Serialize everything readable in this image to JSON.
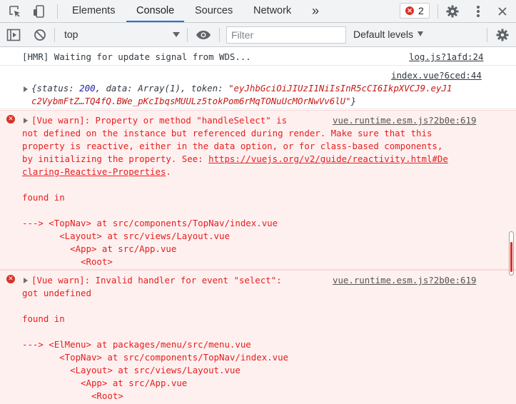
{
  "tabs": [
    {
      "label": "Elements"
    },
    {
      "label": "Console"
    },
    {
      "label": "Sources"
    },
    {
      "label": "Network"
    }
  ],
  "active_tab": "Console",
  "more_tabs_glyph": "»",
  "error_count": "2",
  "toolbar": {
    "context": "top",
    "filter_placeholder": "Filter",
    "levels_label": "Default levels"
  },
  "messages": [
    {
      "type": "log",
      "text": "[HMR] Waiting for update signal from WDS...",
      "source": "log.js?1afd:24"
    },
    {
      "type": "log",
      "source": "index.vue?6ced:44",
      "object": {
        "brace_open": "{",
        "status_key": "status: ",
        "status_val": "200",
        "sep1": ", ",
        "data_key": "data: ",
        "data_val": "Array(1)",
        "sep2": ", ",
        "token_key": "token: ",
        "token_line1": "\"eyJhbGciOiJIUzI1NiIsInR5cCI6IkpXVCJ9.eyJ1",
        "token_line2": "c2VybmFtZ…TQ4fQ.BWe_pKcIbqsMUULz5tokPom6rMqTONuUcMOrNwVv6lU\"",
        "brace_close": "}"
      }
    },
    {
      "type": "error",
      "source": "vue.runtime.esm.js?2b0e:619",
      "first_line": "[Vue warn]: Property or method \"handleSelect\" is",
      "lines": [
        "not defined on the instance but referenced during render. Make sure that this",
        "property is reactive, either in the data option, or for class-based components,",
        "by initializing the property. See: "
      ],
      "link_part1": "https://vuejs.org/v2/guide/reactivity.html#De",
      "link_part2": "claring-Reactive-Properties",
      "link_tail": ".",
      "found_in": "found in",
      "trace": [
        "---> <TopNav> at src/components/TopNav/index.vue",
        "       <Layout> at src/views/Layout.vue",
        "         <App> at src/App.vue",
        "           <Root>"
      ]
    },
    {
      "type": "error",
      "source": "vue.runtime.esm.js?2b0e:619",
      "first_line": "[Vue warn]: Invalid handler for event \"select\":",
      "lines": [
        "got undefined"
      ],
      "found_in": "found in",
      "trace": [
        "---> <ElMenu> at packages/menu/src/menu.vue",
        "       <TopNav> at src/components/TopNav/index.vue",
        "         <Layout> at src/views/Layout.vue",
        "           <App> at src/App.vue",
        "             <Root>"
      ]
    }
  ],
  "colors": {
    "error_text": "#e41e1e",
    "error_bg": "#fff0f0",
    "accent": "#1a73e8"
  },
  "icons": [
    "inspect-element-icon",
    "device-toolbar-icon",
    "more-tabs-icon",
    "error-circle-icon",
    "settings-gear-icon",
    "kebab-menu-icon",
    "sidebar-toggle-icon",
    "clear-console-icon",
    "dropdown-arrow-icon",
    "eye-icon",
    "console-settings-gear-icon",
    "expand-triangle-icon"
  ]
}
